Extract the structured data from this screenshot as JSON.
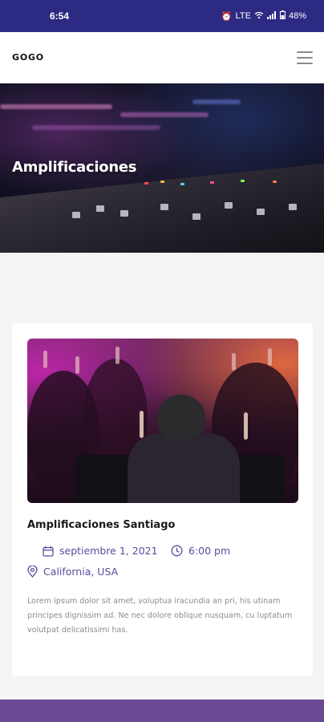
{
  "status_bar": {
    "time": "6:54",
    "icons": [
      "alarm-icon",
      "data-icon",
      "wifi-icon",
      "signal-icon",
      "battery-icon"
    ],
    "network_label": "LTE",
    "battery": "48%"
  },
  "header": {
    "brand": "GOGO",
    "menu_icon": "hamburger-menu-icon"
  },
  "hero": {
    "title": "Amplificaciones"
  },
  "event": {
    "title": "Amplificaciones Santiago",
    "date": "septiembre 1, 2021",
    "time": "6:00 pm",
    "location": "California, USA",
    "description": "Lorem ipsum dolor sit amet, voluptua iracundia an pri, his utinam principes dignissim ad. Ne nec dolore oblique nusquam, cu luptatum volutpat delicatissimi has."
  },
  "colors": {
    "status_bar": "#2c2a82",
    "accent": "#5b4a9c",
    "footer": "#6b4a93"
  }
}
